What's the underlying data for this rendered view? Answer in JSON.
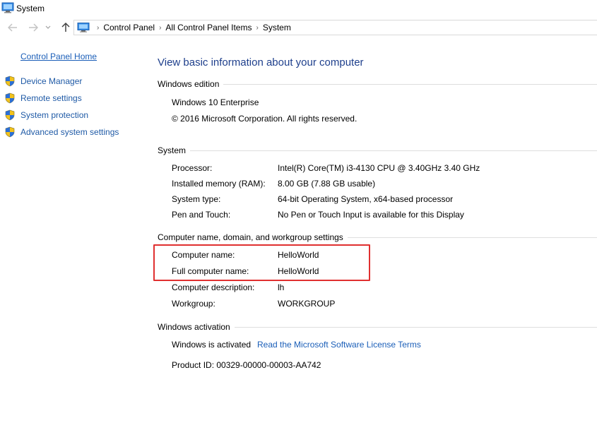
{
  "window": {
    "title": "System",
    "icon": "computer-icon"
  },
  "nav": {
    "back_icon": "arrow-left-icon",
    "forward_icon": "arrow-right-icon",
    "recent_icon": "chevron-down-icon",
    "up_icon": "arrow-up-icon",
    "breadcrumbs": [
      "Control Panel",
      "All Control Panel Items",
      "System"
    ]
  },
  "sidebar": {
    "home_link": "Control Panel Home",
    "items": [
      {
        "label": "Device Manager",
        "icon": "shield-icon"
      },
      {
        "label": "Remote settings",
        "icon": "shield-icon"
      },
      {
        "label": "System protection",
        "icon": "shield-icon"
      },
      {
        "label": "Advanced system settings",
        "icon": "shield-icon"
      }
    ]
  },
  "main": {
    "heading": "View basic information about your computer",
    "edition": {
      "title": "Windows edition",
      "name": "Windows 10 Enterprise",
      "copyright": "© 2016 Microsoft Corporation. All rights reserved."
    },
    "system": {
      "title": "System",
      "rows": [
        {
          "label": "Processor:",
          "value": "Intel(R) Core(TM) i3-4130 CPU @ 3.40GHz   3.40 GHz"
        },
        {
          "label": "Installed memory (RAM):",
          "value": "8.00 GB (7.88 GB usable)"
        },
        {
          "label": "System type:",
          "value": "64-bit Operating System, x64-based processor"
        },
        {
          "label": "Pen and Touch:",
          "value": "No Pen or Touch Input is available for this Display"
        }
      ]
    },
    "computer_name": {
      "title": "Computer name, domain, and workgroup settings",
      "rows": [
        {
          "label": "Computer name:",
          "value": "HelloWorld"
        },
        {
          "label": "Full computer name:",
          "value": "HelloWorld"
        },
        {
          "label": "Computer description:",
          "value": "lh"
        },
        {
          "label": "Workgroup:",
          "value": "WORKGROUP"
        }
      ]
    },
    "activation": {
      "title": "Windows activation",
      "status": "Windows is activated",
      "license_link": "Read the Microsoft Software License Terms",
      "product_id": "Product ID:  00329-00000-00003-AA742"
    }
  },
  "colors": {
    "link": "#1a5eb8",
    "heading": "#1e3f8c",
    "highlight": "#e03030"
  }
}
